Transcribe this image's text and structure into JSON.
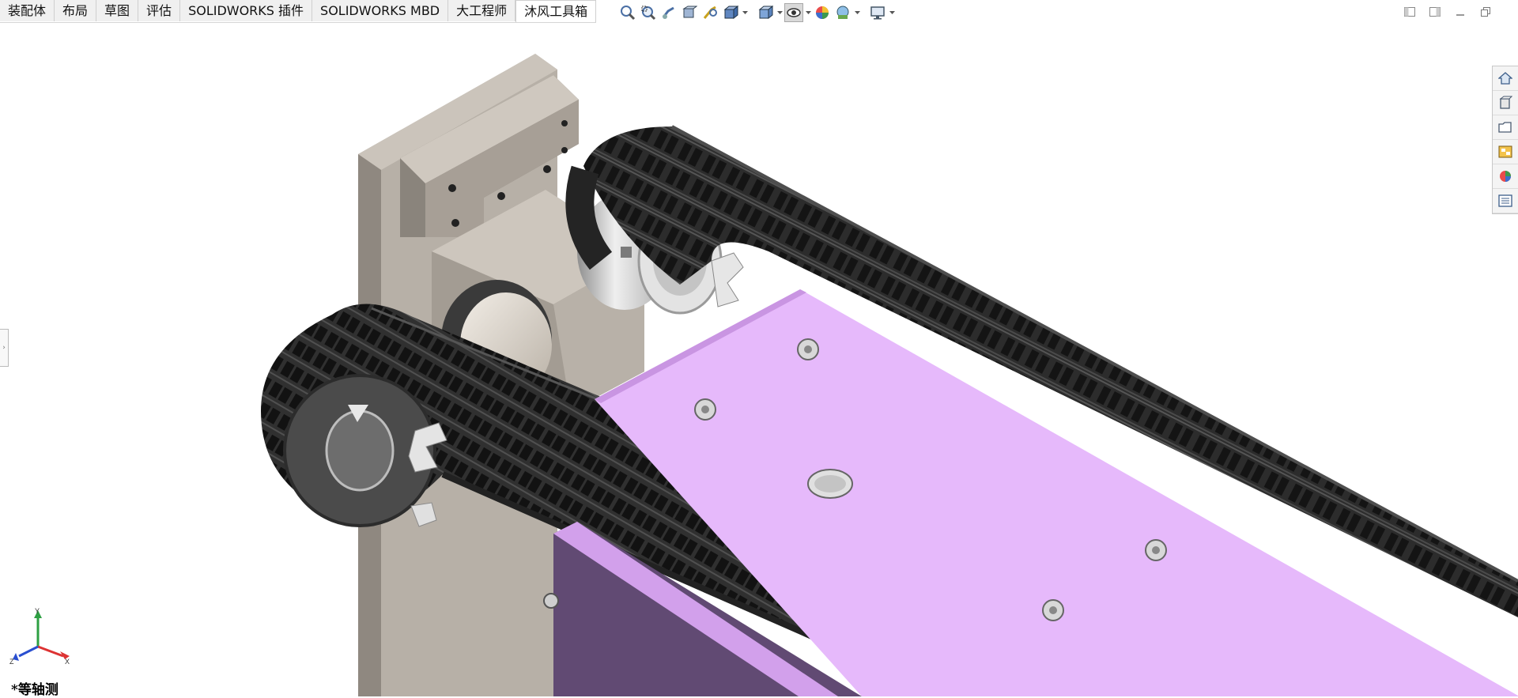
{
  "tabs": [
    {
      "label": "装配体",
      "active": false
    },
    {
      "label": "布局",
      "active": false
    },
    {
      "label": "草图",
      "active": false
    },
    {
      "label": "评估",
      "active": false
    },
    {
      "label": "SOLIDWORKS 插件",
      "active": false
    },
    {
      "label": "SOLIDWORKS MBD",
      "active": false
    },
    {
      "label": "大工程师",
      "active": false
    },
    {
      "label": "沐风工具箱",
      "active": true
    }
  ],
  "view_toolbar": [
    {
      "icon": "zoom-to-fit-icon"
    },
    {
      "icon": "zoom-to-area-icon"
    },
    {
      "icon": "previous-view-icon"
    },
    {
      "icon": "section-view-icon"
    },
    {
      "icon": "dynamic-annotation-icon"
    },
    {
      "icon": "view-orientation-icon",
      "dropdown": true
    },
    {
      "icon": "display-style-icon",
      "dropdown": true
    },
    {
      "icon": "hide-show-items-icon",
      "dropdown": true,
      "pressed": true
    },
    {
      "icon": "edit-appearance-icon"
    },
    {
      "icon": "apply-scene-icon",
      "dropdown": true
    },
    {
      "icon": "view-settings-icon",
      "dropdown": true
    }
  ],
  "window_controls": [
    "tile-left-icon",
    "tile-right-icon",
    "minimize-icon",
    "restore-icon"
  ],
  "task_pane": [
    "home-icon",
    "design-library-icon",
    "file-explorer-icon",
    "view-palette-icon",
    "appearances-icon",
    "custom-properties-icon"
  ],
  "triad": {
    "x": "X",
    "y": "Y",
    "z": "Z"
  },
  "view_label": "*等轴测",
  "colors": {
    "chain": "#2a2a2a",
    "chain_light": "#3c3c3c",
    "plate_top": "#e6b9fb",
    "plate_side": "#614a73",
    "bracket": "#b4ada4",
    "bracket_dark": "#7d776f",
    "sprocket": "#4d4d4d",
    "bearing": "#d0d0d0"
  }
}
